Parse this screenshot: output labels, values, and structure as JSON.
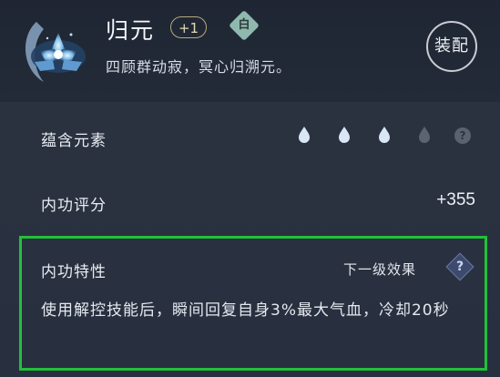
{
  "header": {
    "title": "归元",
    "level_badge": "+1",
    "tier_glyph": "白",
    "subtitle": "四顾群动寂，冥心归溯元。",
    "equip_button": "装配"
  },
  "elements": {
    "label": "蕴含元素",
    "drops_filled": 3,
    "drops_total": 4,
    "hint_glyph": "?",
    "colors": {
      "filled": "#d9e6f5",
      "empty": "#5c6472"
    }
  },
  "score": {
    "label": "内功评分",
    "value": "+355"
  },
  "trait": {
    "label": "内功特性",
    "next_level_link": "下一级效果",
    "help_glyph": "?",
    "description": "使用解控技能后，瞬间回复自身3%最大气血，冷却20秒",
    "highlight_color": "#22c03a"
  }
}
